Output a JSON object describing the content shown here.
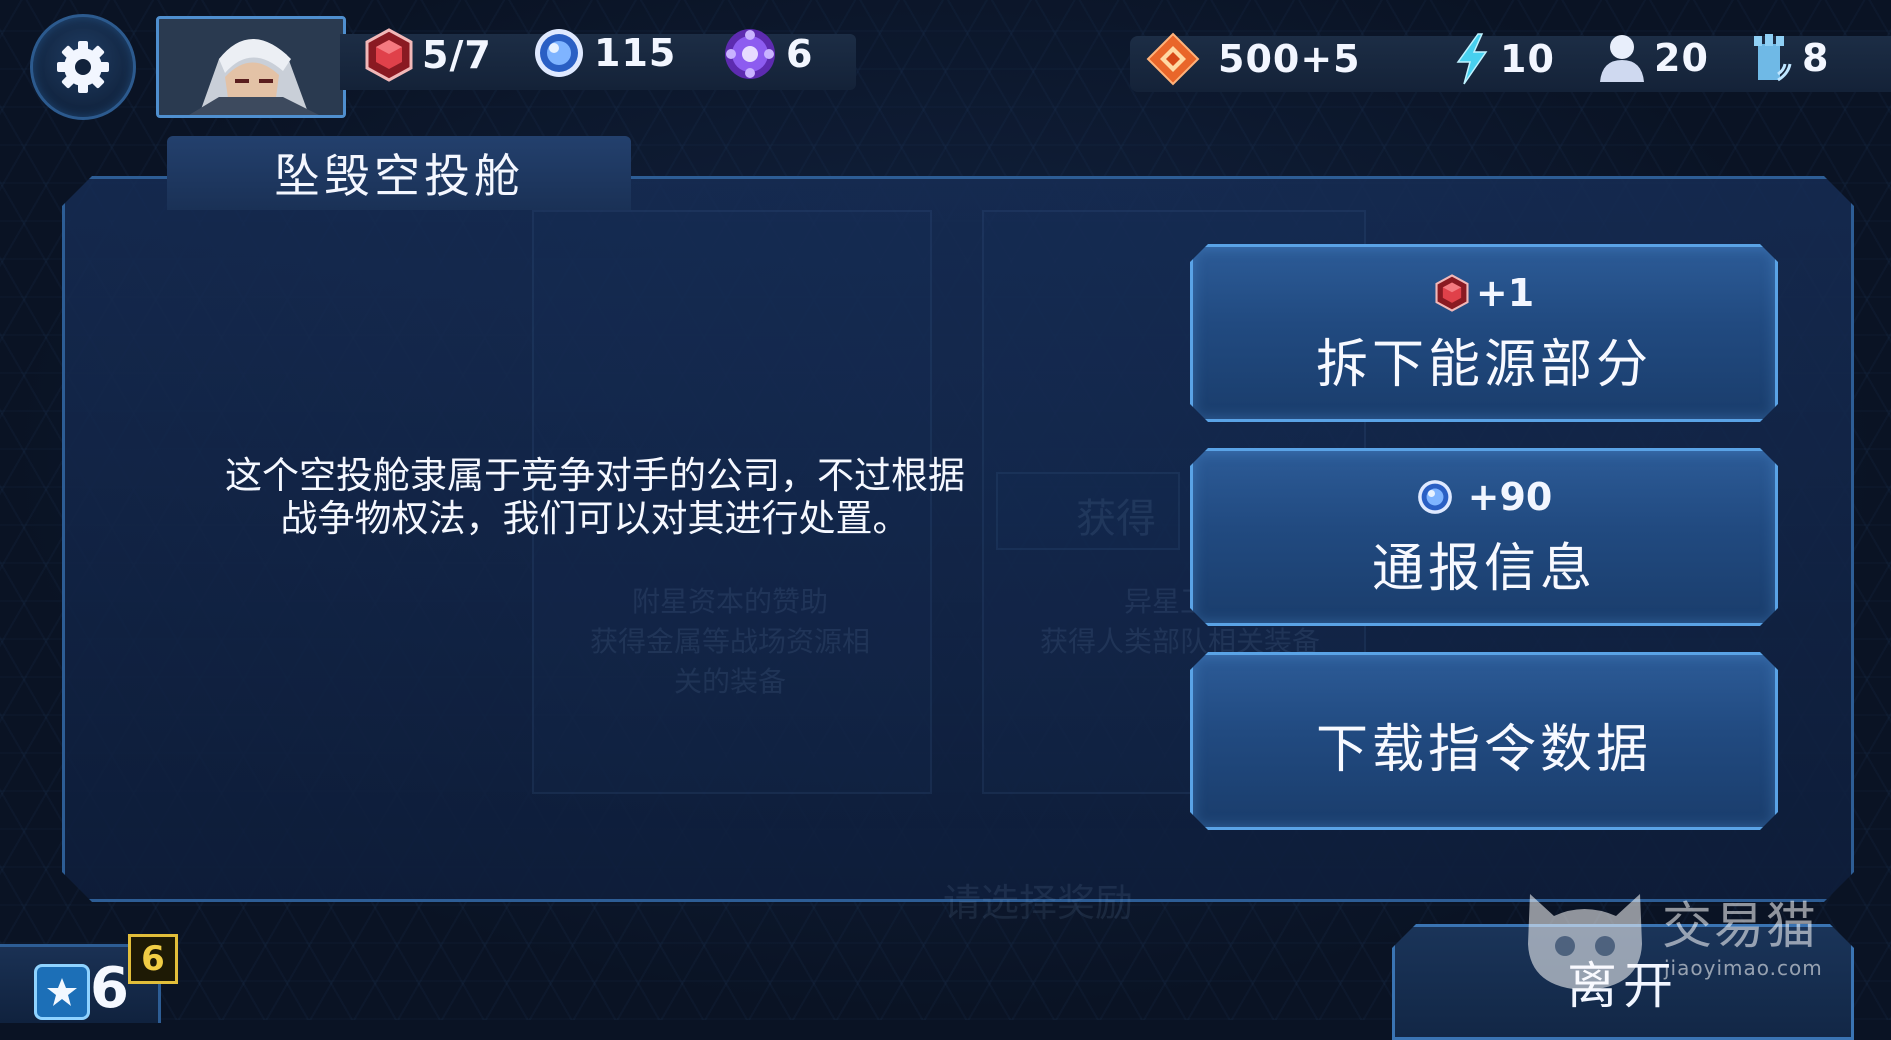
{
  "hud": {
    "power_cells": "5/7",
    "energy_orbs": "115",
    "crystals": "6",
    "credits": "500+5",
    "energy": "10",
    "crew": "20",
    "signal": "8"
  },
  "event": {
    "title": "坠毁空投舱",
    "description": "这个空投舱隶属于竞争对手的公司，不过根据战争物权法，我们可以对其进行处置。"
  },
  "choices": [
    {
      "reward": "+1",
      "reward_icon": "power-cell-icon",
      "label": "拆下能源部分"
    },
    {
      "reward": "+90",
      "reward_icon": "energy-orb-icon",
      "label": "通报信息"
    },
    {
      "reward": "",
      "reward_icon": "",
      "label": "下载指令数据"
    }
  ],
  "footer": {
    "level": "6",
    "level_badge": "6",
    "leave_label": "离开"
  },
  "background_ghost": {
    "left_card_text": "附星资本的赞助\n获得金属等战场资源相\n关的装备",
    "right_card_text": "异星卫士\n获得人类部队相关装备",
    "center_tag": "获得",
    "bottom_prompt": "请选择奖励"
  },
  "watermark": {
    "brand": "交易猫",
    "url": "jiaoyimao.com"
  },
  "colors": {
    "panel_border": "#2d5d95",
    "button_fill": "#2c5b97",
    "button_border": "#5aa3e6",
    "power_cell_red": "#d8343c",
    "orb_blue": "#4a8cf0",
    "crystal_purple": "#7a3fd6",
    "credit_orange": "#e9662a",
    "energy_cyan": "#3fc6e8",
    "badge_gold": "#e2be3a"
  }
}
